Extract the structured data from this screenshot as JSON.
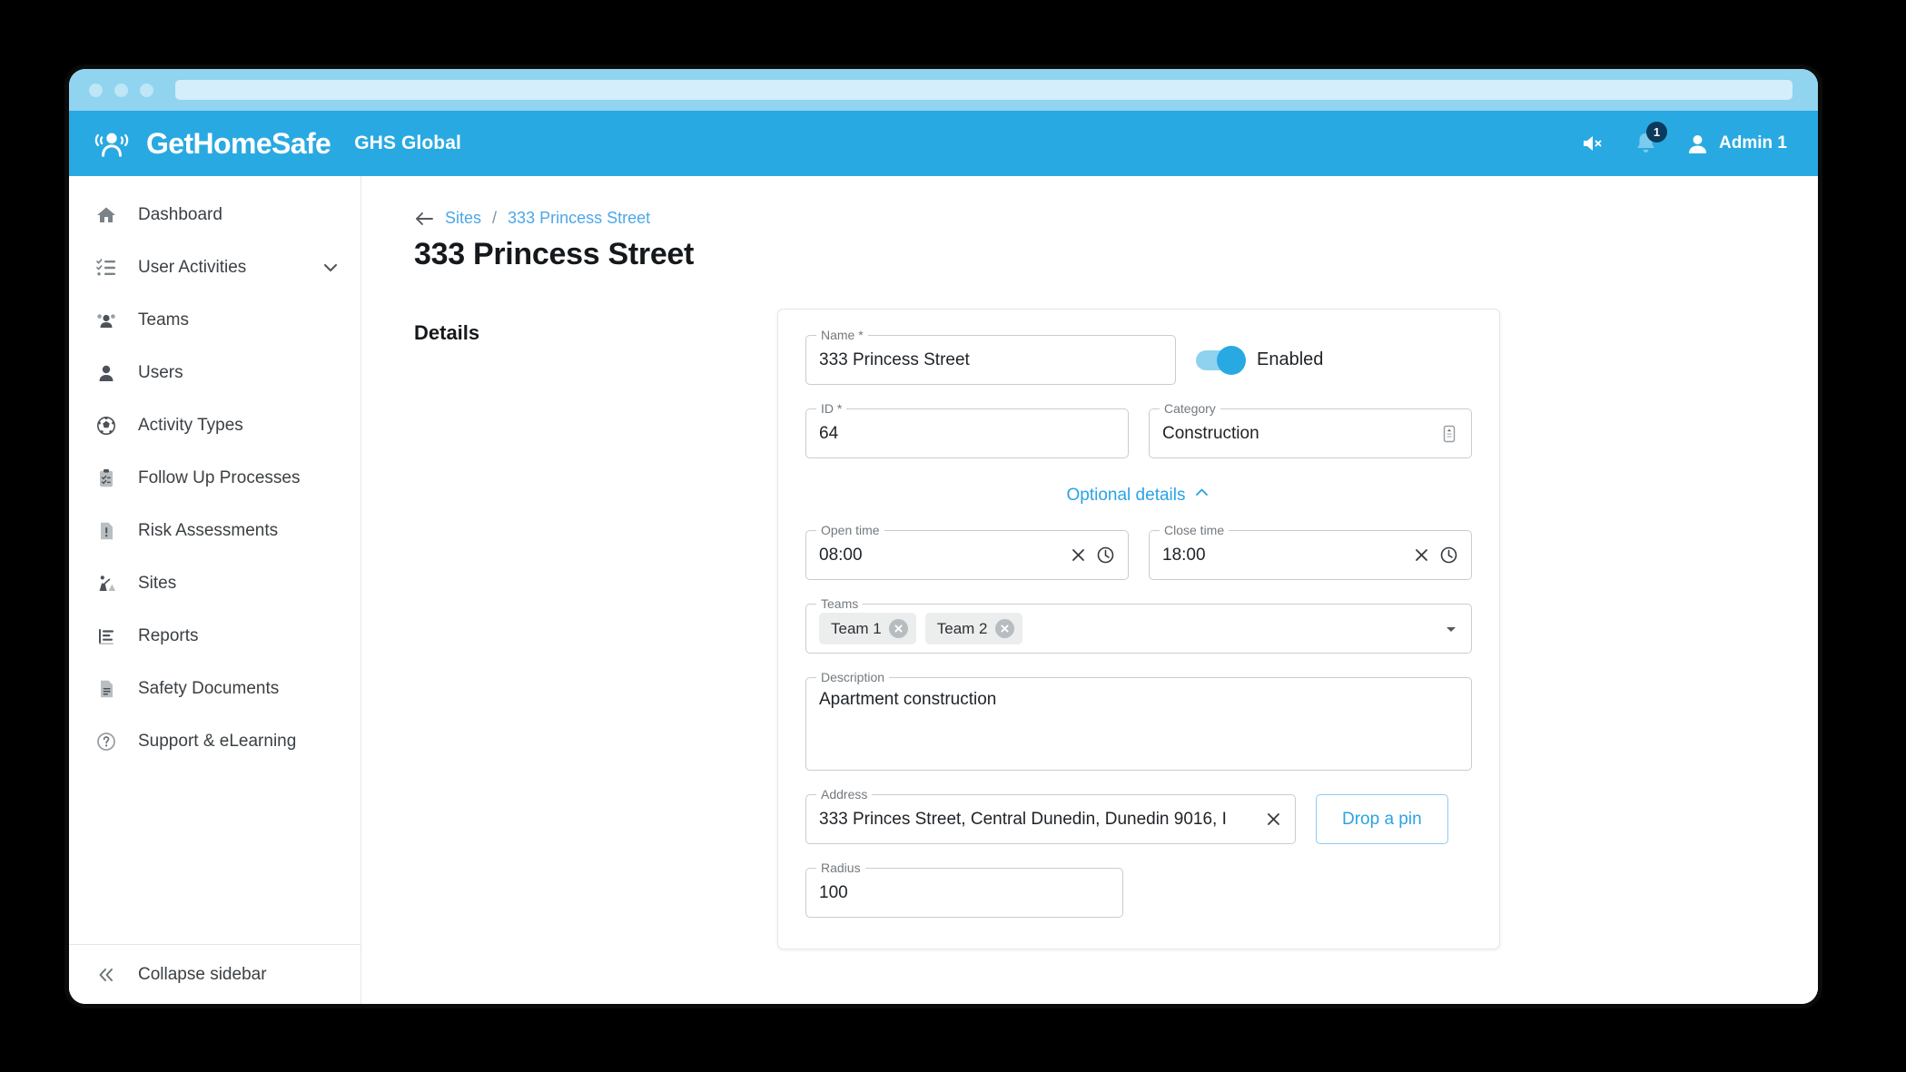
{
  "browser": {
    "url_value": ""
  },
  "header": {
    "logo_text": "GetHomeSafe",
    "tenant": "GHS Global",
    "mute_icon": "speaker-muted-icon",
    "notifications_icon": "bell-icon",
    "notification_count": "1",
    "user_name": "Admin 1",
    "avatar_icon": "person-icon"
  },
  "sidebar": {
    "items": [
      {
        "label": "Dashboard",
        "icon": "home-icon",
        "has_caret": false
      },
      {
        "label": "User Activities",
        "icon": "checklist-icon",
        "has_caret": true
      },
      {
        "label": "Teams",
        "icon": "group-icon",
        "has_caret": false
      },
      {
        "label": "Users",
        "icon": "person-icon",
        "has_caret": false
      },
      {
        "label": "Activity Types",
        "icon": "ball-icon",
        "has_caret": false
      },
      {
        "label": "Follow Up Processes",
        "icon": "clipboard-check-icon",
        "has_caret": false
      },
      {
        "label": "Risk Assessments",
        "icon": "document-alert-icon",
        "has_caret": false
      },
      {
        "label": "Sites",
        "icon": "construction-icon",
        "has_caret": false
      },
      {
        "label": "Reports",
        "icon": "report-bars-icon",
        "has_caret": false
      },
      {
        "label": "Safety Documents",
        "icon": "document-lines-icon",
        "has_caret": false
      },
      {
        "label": "Support & eLearning",
        "icon": "question-circle-icon",
        "has_caret": false
      }
    ],
    "collapse_label": "Collapse sidebar",
    "collapse_icon": "double-chevron-left-icon"
  },
  "breadcrumb": {
    "back_icon": "arrow-left-icon",
    "parent": "Sites",
    "separator": "/",
    "current": "333 Princess Street"
  },
  "page": {
    "title": "333 Princess Street",
    "section_label": "Details"
  },
  "form": {
    "name": {
      "label": "Name *",
      "value": "333 Princess Street"
    },
    "enabled_toggle": {
      "label": "Enabled",
      "state": "on"
    },
    "id": {
      "label": "ID *",
      "value": "64"
    },
    "category": {
      "label": "Category",
      "value": "Construction",
      "icon": "category-tag-icon"
    },
    "optional_details": {
      "label": "Optional details",
      "icon": "chevron-up-icon"
    },
    "open_time": {
      "label": "Open time",
      "value": "08:00",
      "clear_icon": "close-icon",
      "picker_icon": "clock-icon"
    },
    "close_time": {
      "label": "Close time",
      "value": "18:00",
      "clear_icon": "close-icon",
      "picker_icon": "clock-icon"
    },
    "teams": {
      "label": "Teams",
      "chips": [
        "Team 1",
        "Team 2"
      ],
      "caret_icon": "chevron-down-icon"
    },
    "description": {
      "label": "Description",
      "value": "Apartment construction"
    },
    "address": {
      "label": "Address",
      "value": "333 Princes Street, Central Dunedin, Dunedin 9016, I",
      "clear_icon": "close-icon"
    },
    "drop_pin_button": "Drop a pin",
    "radius": {
      "label": "Radius",
      "value": "100"
    }
  },
  "colors": {
    "brand_blue": "#29a9e1",
    "link_blue": "#4da7e8",
    "chrome_blue": "#90d4ef",
    "badge_navy": "#0b3a5d",
    "text_dark": "#16191c"
  }
}
